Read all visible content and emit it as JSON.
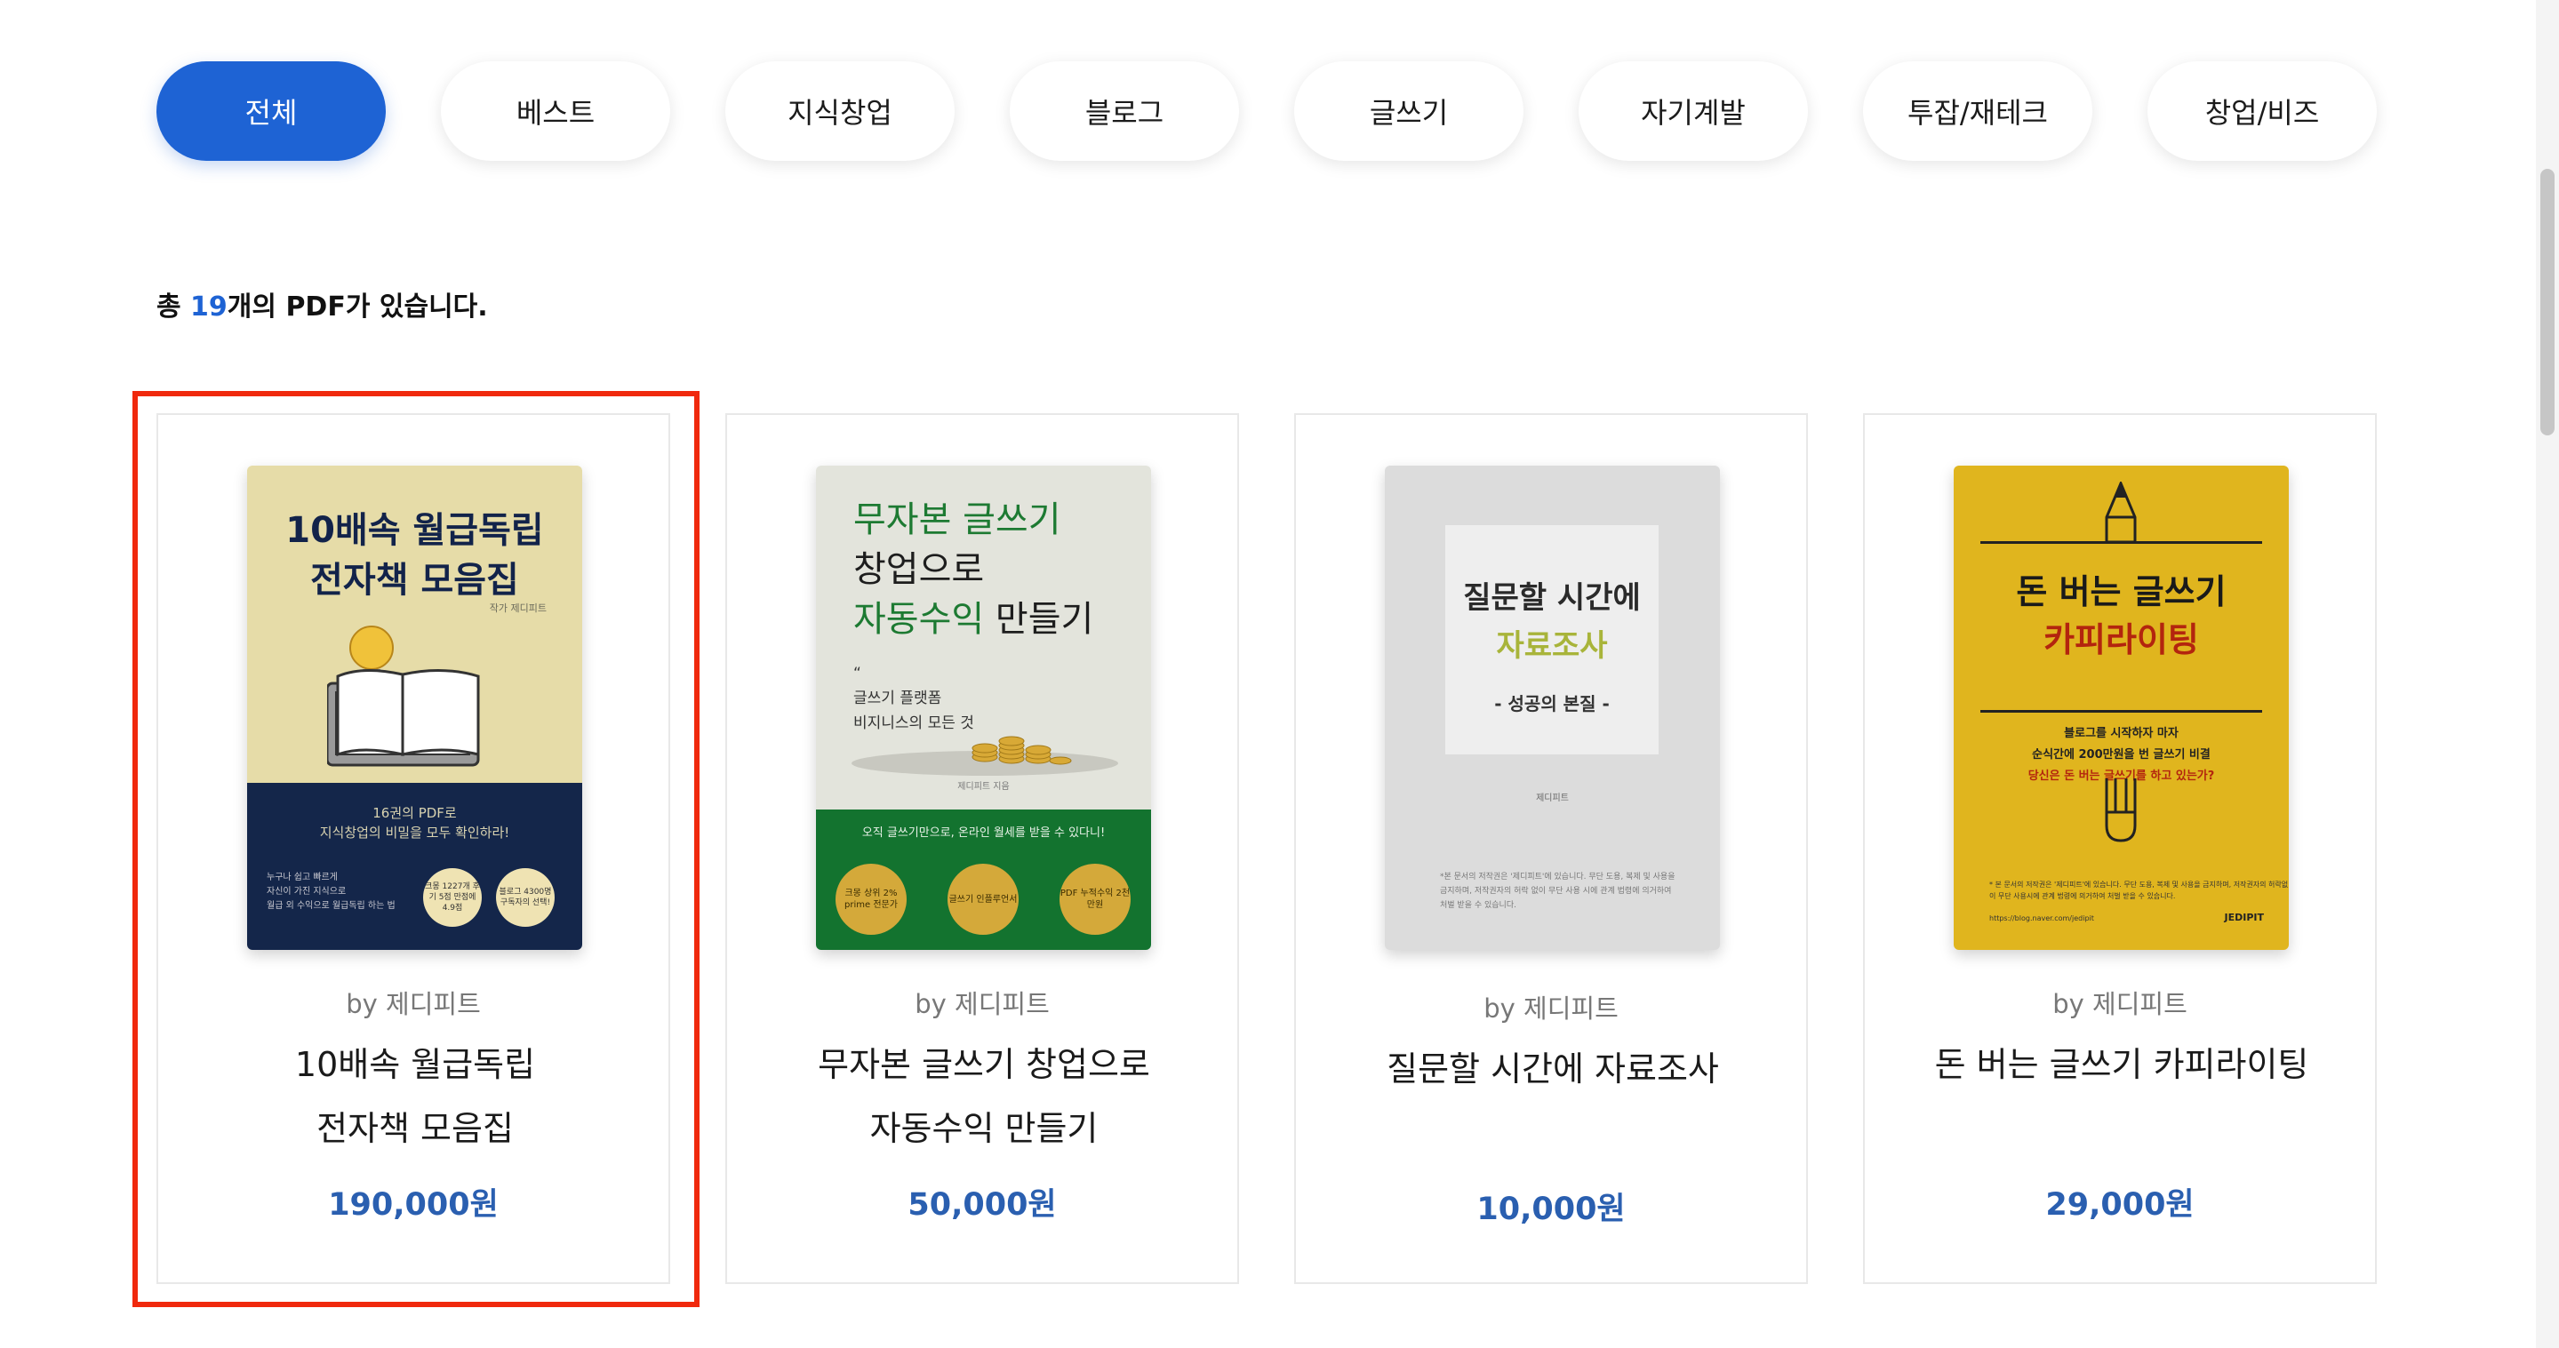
{
  "tabs": [
    {
      "label": "전체",
      "active": true
    },
    {
      "label": "베스트"
    },
    {
      "label": "지식창업"
    },
    {
      "label": "블로그"
    },
    {
      "label": "글쓰기"
    },
    {
      "label": "자기계발"
    },
    {
      "label": "투잡/재테크"
    },
    {
      "label": "창업/비즈"
    }
  ],
  "summary": {
    "prefix": "총 ",
    "count": "19",
    "suffix": "개의 PDF가 있습니다."
  },
  "products": [
    {
      "author": "by 제디피트",
      "title_line1": "10배속 월급독립",
      "title_line2": "전자책 모음집",
      "price": "190,000원",
      "cover": {
        "title_line1": "10배속 월급독립",
        "title_line2": "전자책 모음집",
        "author": "작가 제디피트",
        "sub_line1": "16권의 PDF로",
        "sub_line2": "지식창업의 비밀을 모두 확인하라!",
        "desc_line1": "누구나 쉽고 빠르게",
        "desc_line2": "자신이 가진 지식으로",
        "desc_line3": "월급 외 수익으로 월급독립 하는 법",
        "badge1": "크몽 1227개 후기 5점 만점에 4.9점",
        "badge2": "블로그 4300명 구독자의 선택!"
      }
    },
    {
      "author": "by 제디피트",
      "title_line1": "무자본 글쓰기 창업으로",
      "title_line2": "자동수익 만들기",
      "price": "50,000원",
      "cover": {
        "t_a": "무자본 글쓰기",
        "t_b": "창업으로",
        "t_c": "자동수익",
        "t_d": " 만들기",
        "quote": "“",
        "sub_line1": "글쓰기 플랫폼",
        "sub_line2": "비지니스의 모든 것",
        "author": "제디피트 지음",
        "bottom_line": "오직 글쓰기만으로, 온라인 월세를 받을 수 있다니!",
        "seal1": "크몽 상위 2% prime 전문가",
        "seal2": "글쓰기 인플루언서",
        "seal3": "PDF 누적수익 2천만원"
      }
    },
    {
      "author": "by 제디피트",
      "title_line1": "질문할 시간에 자료조사",
      "price": "10,000원",
      "cover": {
        "t_a": "질문할 시간에",
        "t_b": "자료조사",
        "sub": "- 성공의 본질 -",
        "author": "제디피트",
        "desc": "*본 문서의 저작권은 '제디피트'에 있습니다. 무단 도용, 복제 및 사용을 금지하며, 저작권자의 허락 없이 무단 사용 시에 관계 법령에 의거하여 처벌 받을 수 있습니다."
      }
    },
    {
      "author": "by 제디피트",
      "title_line1": "돈 버는 글쓰기 카피라이팅",
      "price": "29,000원",
      "cover": {
        "t_a": "돈 버는 글쓰기",
        "t_b": "카피라이팅",
        "sub_line1": "블로그를 시작하자 마자",
        "sub_line2": "순식간에 200만원을 번 글쓰기 비결",
        "sub_line3": "당신은 돈 버는 글쓰기를 하고 있는가?",
        "desc": "* 본 문서의 저작권은 '제디피트'에 있습니다. 무단 도용, 복제 및 사용을 금지하며, 저작권자의 허락없이 무단 사용시에 관계 법령에 의거하여 처벌 받을 수 있습니다.",
        "url": "https://blog.naver.com/jedipit",
        "brand": "JEDIPIT"
      }
    }
  ],
  "colors": {
    "accent": "#1e63d4",
    "price": "#2a5fb0",
    "highlight": "#f0290d"
  }
}
